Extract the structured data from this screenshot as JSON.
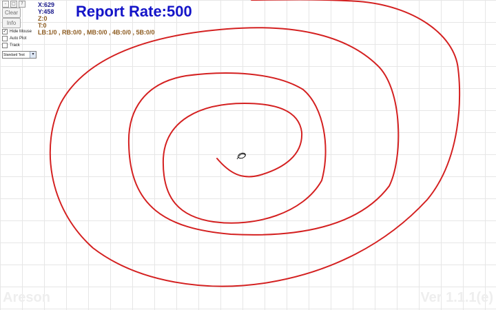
{
  "header": {
    "title": "Report Rate:500"
  },
  "readout": {
    "x": "X:629",
    "y": "Y:458",
    "z": "Z:0",
    "t": "T:0",
    "buttons": "LB:1/0 , RB:0/0 , MB:0/0 , 4B:0/0 , 5B:0/0"
  },
  "toolbar": {
    "icons": [
      "minimize-icon",
      "restore-icon",
      "help-icon"
    ],
    "icon_glyphs": [
      "-",
      "□",
      "?"
    ],
    "clear_label": "Clear",
    "info_label": "Info"
  },
  "options": {
    "hide_mouse": {
      "label": "Hide Mouse",
      "checked": true
    },
    "auto_plot": {
      "label": "Auto Plot",
      "checked": false
    },
    "track": {
      "label": "Track",
      "checked": false
    }
  },
  "mode": {
    "selected": "Standard Test"
  },
  "footer": {
    "brand": "Areson",
    "version": "Ver 1.1.1(e)"
  },
  "colors": {
    "trace": "#d42020",
    "title": "#1414c8",
    "coords": "#1a1a8c",
    "stats": "#8c5a1e",
    "grid": "#e6e6e6"
  }
}
